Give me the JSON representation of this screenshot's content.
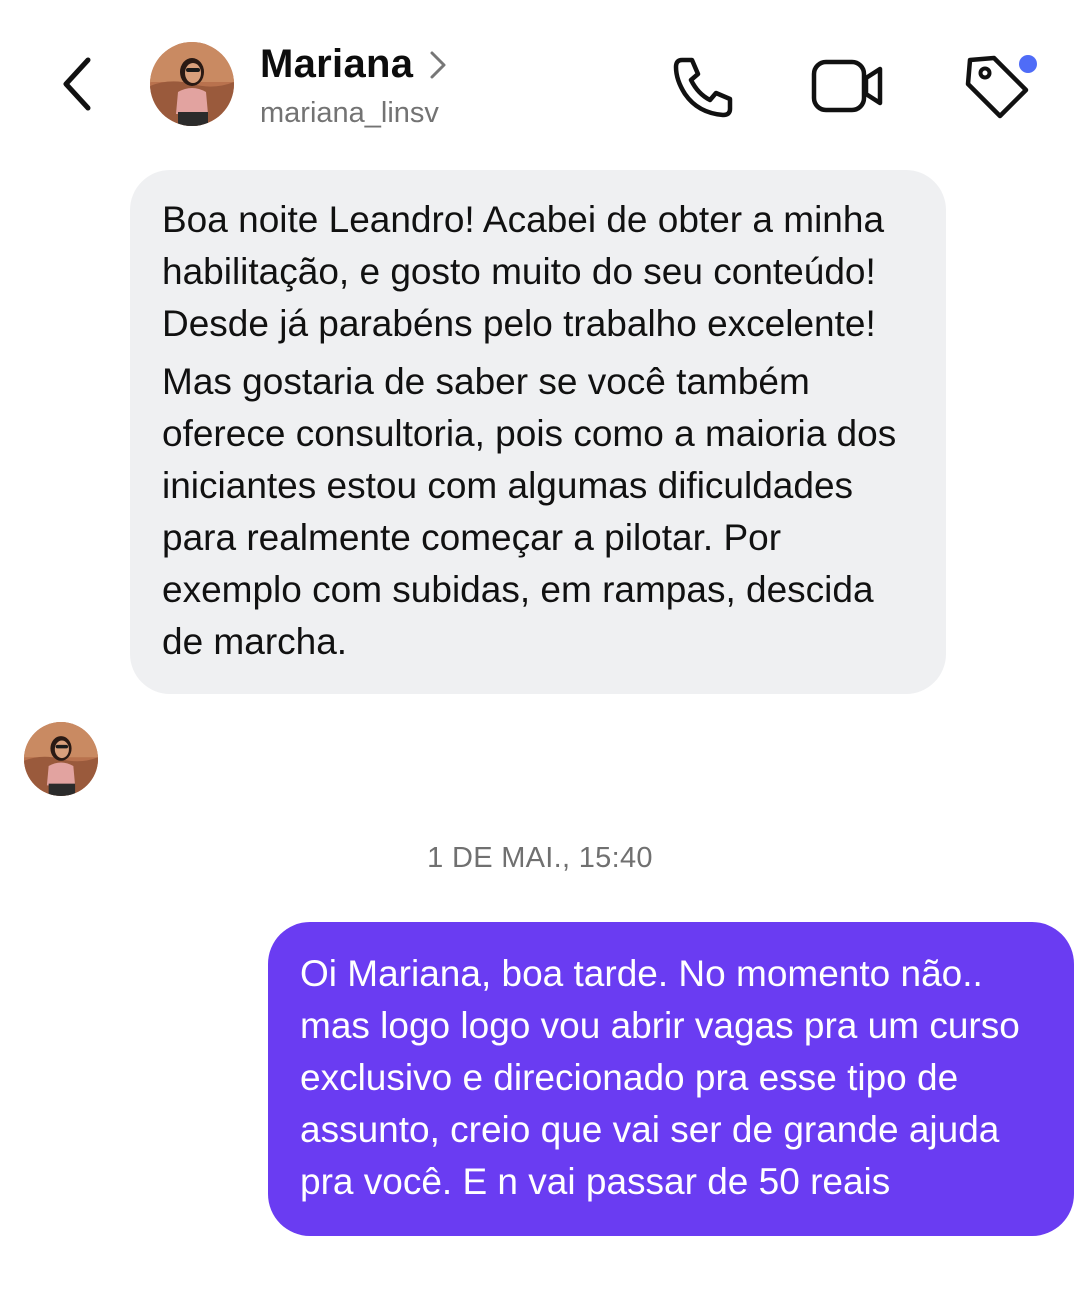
{
  "header": {
    "contact_name": "Mariana",
    "username": "mariana_linsv",
    "icons": {
      "back": "chevron-left-icon",
      "name_chevron": "chevron-right-icon",
      "call": "phone-icon",
      "video": "video-camera-icon",
      "tag": "tag-icon",
      "tag_badge_color": "#4f6cf7"
    }
  },
  "messages": [
    {
      "direction": "incoming",
      "paragraphs": [
        "Boa noite Leandro! Acabei de obter a minha habilitação, e gosto muito do seu conteúdo! Desde já parabéns pelo trabalho excelente!",
        "Mas gostaria de saber se você também oferece consultoria, pois como a maioria dos iniciantes estou com algumas dificuldades para realmente começar a pilotar. Por exemplo com subidas, em rampas, descida de marcha."
      ]
    },
    {
      "direction": "outgoing",
      "timestamp": "1 DE MAI., 15:40",
      "text": "Oi Mariana, boa tarde. No momento não.. mas logo logo vou abrir vagas pra um curso exclusivo e direcionado pra esse tipo de assunto, creio que vai ser de grande ajuda pra você. E n vai passar de 50 reais"
    }
  ],
  "colors": {
    "incoming_bubble": "#eff0f2",
    "outgoing_bubble": "#6a3cf2",
    "outgoing_text": "#ffffff",
    "muted_text": "#737373"
  }
}
